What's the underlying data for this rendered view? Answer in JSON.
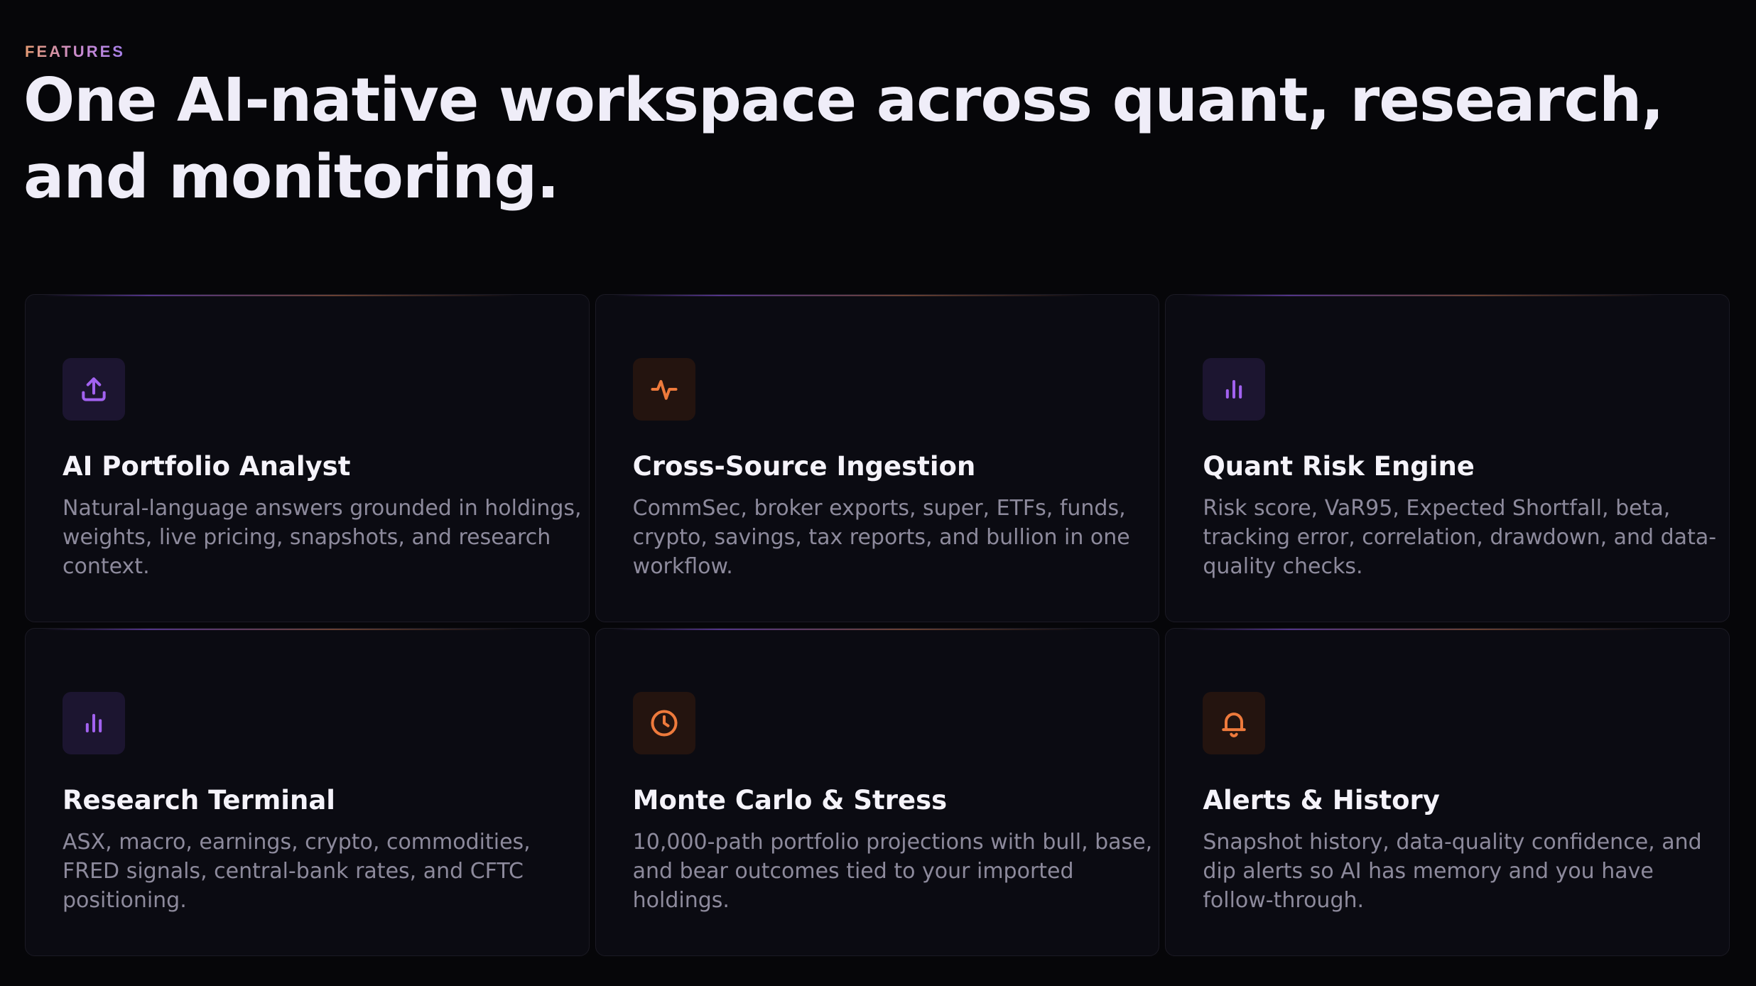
{
  "section": {
    "eyebrow": "FEATURES",
    "headline": "One AI-native workspace across quant, research, and monitoring."
  },
  "colors": {
    "background": "#060609",
    "card_background": "#0b0b12",
    "accent_purple": "#a262f0",
    "accent_orange": "#ee7a3c",
    "title_text": "#f5f3fa",
    "body_text": "#8d8a9c"
  },
  "features": [
    {
      "icon": "upload-icon",
      "accent": "purple",
      "title": "AI Portfolio Analyst",
      "description": "Natural-language answers grounded in holdings, weights, live pricing, snapshots, and research context."
    },
    {
      "icon": "activity-icon",
      "accent": "orange",
      "title": "Cross-Source Ingestion",
      "description": "CommSec, broker exports, super, ETFs, funds, crypto, savings, tax reports, and bullion in one workflow."
    },
    {
      "icon": "bar-chart-icon",
      "accent": "purple",
      "title": "Quant Risk Engine",
      "description": "Risk score, VaR95, Expected Shortfall, beta, tracking error, correlation, drawdown, and data-quality checks."
    },
    {
      "icon": "bar-chart-icon",
      "accent": "purple",
      "title": "Research Terminal",
      "description": "ASX, macro, earnings, crypto, commodities, FRED signals, central-bank rates, and CFTC positioning."
    },
    {
      "icon": "clock-icon",
      "accent": "orange",
      "title": "Monte Carlo & Stress",
      "description": "10,000-path portfolio projections with bull, base, and bear outcomes tied to your imported holdings."
    },
    {
      "icon": "bell-icon",
      "accent": "orange",
      "title": "Alerts & History",
      "description": "Snapshot history, data-quality confidence, and dip alerts so AI has memory and you have follow-through."
    }
  ]
}
